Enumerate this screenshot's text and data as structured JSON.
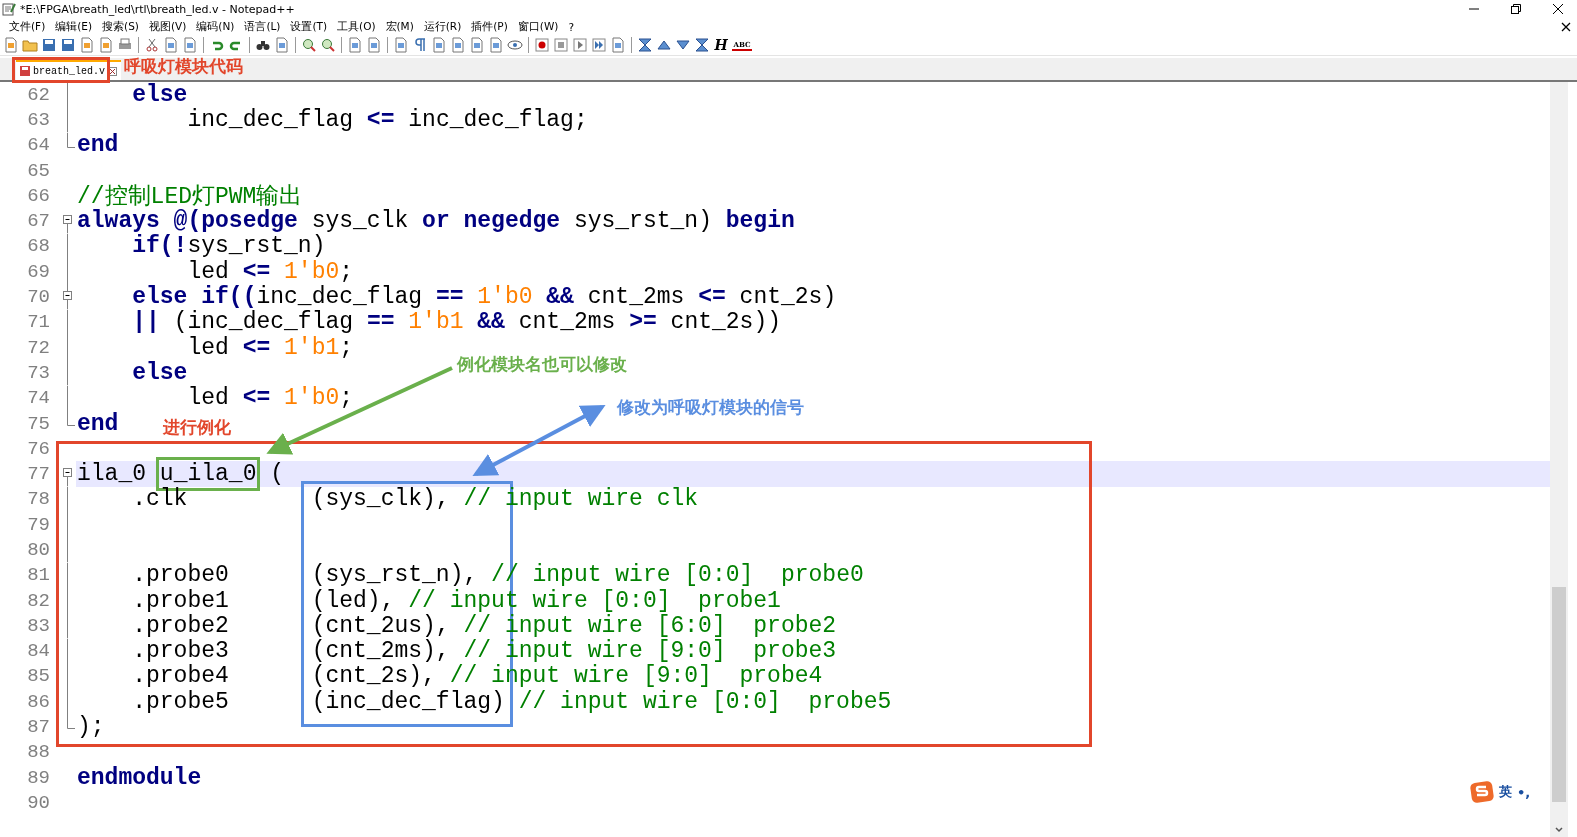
{
  "window": {
    "title": "*E:\\FPGA\\breath_led\\rtl\\breath_led.v - Notepad++"
  },
  "menu": [
    "文件(F)",
    "编辑(E)",
    "搜索(S)",
    "视图(V)",
    "编码(N)",
    "语言(L)",
    "设置(T)",
    "工具(O)",
    "宏(M)",
    "运行(R)",
    "插件(P)",
    "窗口(W)",
    "?"
  ],
  "toolbar": {
    "heading_glyph": "H",
    "spell_glyph": "ABC"
  },
  "tabs": [
    {
      "label": "breath_led.v",
      "selected": true,
      "modified": true
    }
  ],
  "editor": {
    "lines": [
      {
        "num": "62",
        "fold_start": false,
        "fold_end": false,
        "in_fold": true,
        "current": false,
        "tokens": [
          {
            "kind": "keyword",
            "text": "    else"
          }
        ]
      },
      {
        "num": "63",
        "fold_start": false,
        "fold_end": false,
        "in_fold": true,
        "current": false,
        "tokens": [
          {
            "kind": "plain",
            "text": "        inc_dec_flag "
          },
          {
            "kind": "operator",
            "text": "<="
          },
          {
            "kind": "plain",
            "text": " inc_dec_flag;"
          }
        ]
      },
      {
        "num": "64",
        "fold_start": false,
        "fold_end": true,
        "in_fold": false,
        "current": false,
        "tokens": [
          {
            "kind": "keyword",
            "text": "end"
          }
        ]
      },
      {
        "num": "65",
        "fold_start": false,
        "fold_end": false,
        "in_fold": false,
        "current": false
      },
      {
        "num": "66",
        "fold_start": false,
        "fold_end": false,
        "in_fold": false,
        "current": false,
        "tokens": [
          {
            "kind": "comment",
            "text": "//控制LED灯PWM输出"
          }
        ]
      },
      {
        "num": "67",
        "fold_start": true,
        "fold_end": false,
        "in_fold": false,
        "current": false,
        "tokens": [
          {
            "kind": "keyword",
            "text": "always @(posedge"
          },
          {
            "kind": "plain",
            "text": " sys_clk "
          },
          {
            "kind": "keyword",
            "text": "or negedge"
          },
          {
            "kind": "plain",
            "text": " sys_rst_n) "
          },
          {
            "kind": "keyword",
            "text": "begin"
          }
        ]
      },
      {
        "num": "68",
        "fold_start": false,
        "fold_end": false,
        "in_fold": true,
        "current": false,
        "tokens": [
          {
            "kind": "keyword",
            "text": "    if(!"
          },
          {
            "kind": "plain",
            "text": "sys_rst_n)"
          }
        ]
      },
      {
        "num": "69",
        "fold_start": false,
        "fold_end": false,
        "in_fold": true,
        "current": false,
        "tokens": [
          {
            "kind": "plain",
            "text": "        led "
          },
          {
            "kind": "operator",
            "text": "<= "
          },
          {
            "kind": "number",
            "text": "1'b0"
          },
          {
            "kind": "plain",
            "text": ";"
          }
        ]
      },
      {
        "num": "70",
        "fold_start": true,
        "fold_end": false,
        "in_fold": true,
        "current": false,
        "tokens": [
          {
            "kind": "keyword",
            "text": "    else if(("
          },
          {
            "kind": "plain",
            "text": "inc_dec_flag "
          },
          {
            "kind": "operator",
            "text": "== "
          },
          {
            "kind": "number",
            "text": "1'b0"
          },
          {
            "kind": "operator",
            "text": " &&"
          },
          {
            "kind": "plain",
            "text": " cnt_2ms "
          },
          {
            "kind": "operator",
            "text": "<="
          },
          {
            "kind": "plain",
            "text": " cnt_2s)"
          }
        ]
      },
      {
        "num": "71",
        "fold_start": false,
        "fold_end": false,
        "in_fold": true,
        "current": false,
        "tokens": [
          {
            "kind": "operator",
            "text": "    ||"
          },
          {
            "kind": "plain",
            "text": " (inc_dec_flag "
          },
          {
            "kind": "operator",
            "text": "== "
          },
          {
            "kind": "number",
            "text": "1'b1"
          },
          {
            "kind": "operator",
            "text": " &&"
          },
          {
            "kind": "plain",
            "text": " cnt_2ms "
          },
          {
            "kind": "operator",
            "text": ">="
          },
          {
            "kind": "plain",
            "text": " cnt_2s))"
          }
        ]
      },
      {
        "num": "72",
        "fold_start": false,
        "fold_end": false,
        "in_fold": true,
        "current": false,
        "tokens": [
          {
            "kind": "plain",
            "text": "        led "
          },
          {
            "kind": "operator",
            "text": "<= "
          },
          {
            "kind": "number",
            "text": "1'b1"
          },
          {
            "kind": "plain",
            "text": ";"
          }
        ]
      },
      {
        "num": "73",
        "fold_start": false,
        "fold_end": false,
        "in_fold": true,
        "current": false,
        "tokens": [
          {
            "kind": "keyword",
            "text": "    else"
          }
        ]
      },
      {
        "num": "74",
        "fold_start": false,
        "fold_end": false,
        "in_fold": true,
        "current": false,
        "tokens": [
          {
            "kind": "plain",
            "text": "        led "
          },
          {
            "kind": "operator",
            "text": "<= "
          },
          {
            "kind": "number",
            "text": "1'b0"
          },
          {
            "kind": "plain",
            "text": ";"
          }
        ]
      },
      {
        "num": "75",
        "fold_start": false,
        "fold_end": true,
        "in_fold": false,
        "current": false,
        "tokens": [
          {
            "kind": "keyword",
            "text": "end"
          }
        ]
      },
      {
        "num": "76",
        "fold_start": false,
        "fold_end": false,
        "in_fold": false,
        "current": false
      },
      {
        "num": "77",
        "fold_start": true,
        "fold_end": false,
        "in_fold": false,
        "current": true,
        "tokens": [
          {
            "kind": "plain",
            "text": "ila_0 "
          },
          {
            "kind": "plain",
            "text": "u_ila_0",
            "boxed": true
          },
          {
            "kind": "plain",
            "text": " ("
          }
        ]
      },
      {
        "num": "78",
        "fold_start": false,
        "fold_end": false,
        "in_fold": true,
        "current": false,
        "tokens": [
          {
            "kind": "plain",
            "text": "    .clk         (sys_clk), "
          },
          {
            "kind": "comment",
            "text": "// input wire clk"
          }
        ]
      },
      {
        "num": "79",
        "fold_start": false,
        "fold_end": false,
        "in_fold": true,
        "current": false
      },
      {
        "num": "80",
        "fold_start": false,
        "fold_end": false,
        "in_fold": true,
        "current": false
      },
      {
        "num": "81",
        "fold_start": false,
        "fold_end": false,
        "in_fold": true,
        "current": false,
        "tokens": [
          {
            "kind": "plain",
            "text": "    .probe0      (sys_rst_n), "
          },
          {
            "kind": "comment",
            "text": "// input wire [0:0]  probe0"
          }
        ]
      },
      {
        "num": "82",
        "fold_start": false,
        "fold_end": false,
        "in_fold": true,
        "current": false,
        "tokens": [
          {
            "kind": "plain",
            "text": "    .probe1      (led), "
          },
          {
            "kind": "comment",
            "text": "// input wire [0:0]  probe1"
          }
        ]
      },
      {
        "num": "83",
        "fold_start": false,
        "fold_end": false,
        "in_fold": true,
        "current": false,
        "tokens": [
          {
            "kind": "plain",
            "text": "    .probe2      (cnt_2us), "
          },
          {
            "kind": "comment",
            "text": "// input wire [6:0]  probe2"
          }
        ]
      },
      {
        "num": "84",
        "fold_start": false,
        "fold_end": false,
        "in_fold": true,
        "current": false,
        "tokens": [
          {
            "kind": "plain",
            "text": "    .probe3      (cnt_2ms), "
          },
          {
            "kind": "comment",
            "text": "// input wire [9:0]  probe3"
          }
        ]
      },
      {
        "num": "85",
        "fold_start": false,
        "fold_end": false,
        "in_fold": true,
        "current": false,
        "tokens": [
          {
            "kind": "plain",
            "text": "    .probe4      (cnt_2s), "
          },
          {
            "kind": "comment",
            "text": "// input wire [9:0]  probe4"
          }
        ]
      },
      {
        "num": "86",
        "fold_start": false,
        "fold_end": false,
        "in_fold": true,
        "current": false,
        "tokens": [
          {
            "kind": "plain",
            "text": "    .probe5      (inc_dec_flag) "
          },
          {
            "kind": "comment",
            "text": "// input wire [0:0]  probe5"
          }
        ]
      },
      {
        "num": "87",
        "fold_start": false,
        "fold_end": true,
        "in_fold": false,
        "current": false,
        "tokens": [
          {
            "kind": "plain",
            "text": ");"
          }
        ]
      },
      {
        "num": "88",
        "fold_start": false,
        "fold_end": false,
        "in_fold": false,
        "current": false
      },
      {
        "num": "89",
        "fold_start": false,
        "fold_end": false,
        "in_fold": false,
        "current": false,
        "tokens": [
          {
            "kind": "keyword",
            "text": "endmodule"
          }
        ]
      },
      {
        "num": "90",
        "fold_start": false,
        "fold_end": false,
        "in_fold": false,
        "current": false
      }
    ]
  },
  "annotations": {
    "tab_note": "呼吸灯模块代码",
    "instance_note": "进行例化",
    "rename_note": "例化模块名也可以修改",
    "signal_note": "修改为呼吸灯模块的信号"
  },
  "ime": {
    "mode": "英",
    "punct": "•,"
  }
}
